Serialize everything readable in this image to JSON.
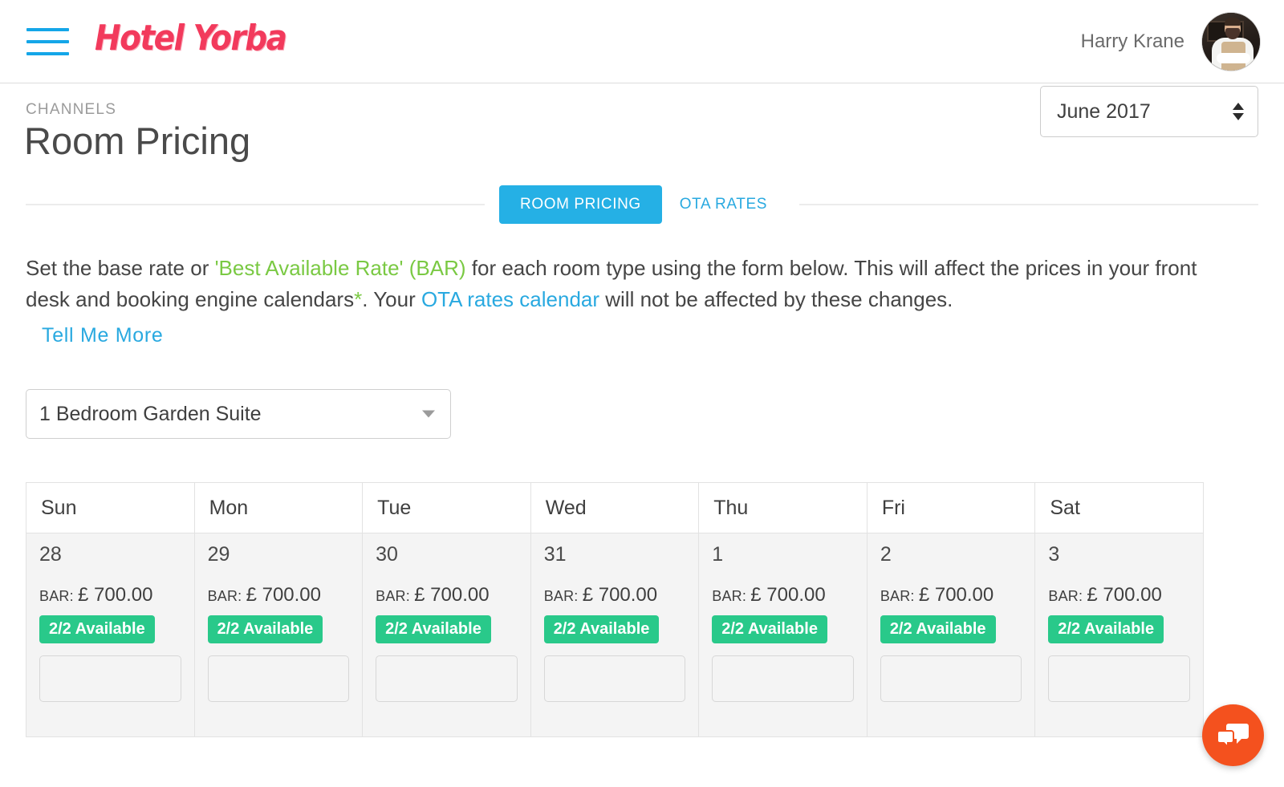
{
  "header": {
    "menu_icon": "hamburger-menu-icon",
    "brand": "Hotel Yorba",
    "user_name": "Harry Krane",
    "avatar_alt": "user-avatar"
  },
  "page": {
    "breadcrumb": "CHANNELS",
    "title": "Room Pricing",
    "month_selected": "June 2017",
    "month_options": [
      "June 2017"
    ]
  },
  "tabs": [
    {
      "label": "ROOM PRICING",
      "active": true
    },
    {
      "label": "OTA RATES",
      "active": false
    }
  ],
  "description": {
    "part1": "Set the base rate or ",
    "bar_term": "'Best Available Rate' (BAR)",
    "part2": " for each room type using the form below. This will affect the prices in your front desk and booking engine calendars",
    "star": "*",
    "part3": ". Your ",
    "ota_link": "OTA rates calendar",
    "part4": " will not be affected by these changes.",
    "tell_me_more": "Tell Me More"
  },
  "room_select": {
    "selected": "1 Bedroom Garden Suite",
    "options": [
      "1 Bedroom Garden Suite"
    ]
  },
  "calendar": {
    "day_headers": [
      "Sun",
      "Mon",
      "Tue",
      "Wed",
      "Thu",
      "Fri",
      "Sat"
    ],
    "bar_label": "BAR:",
    "currency_symbol": "£",
    "rate_input_placeholder": "",
    "rate_input_value": "",
    "rows": [
      {
        "cells": [
          {
            "day": "28",
            "price": "700.00",
            "availability": "2/2 Available",
            "rate_value": ""
          },
          {
            "day": "29",
            "price": "700.00",
            "availability": "2/2 Available",
            "rate_value": ""
          },
          {
            "day": "30",
            "price": "700.00",
            "availability": "2/2 Available",
            "rate_value": ""
          },
          {
            "day": "31",
            "price": "700.00",
            "availability": "2/2 Available",
            "rate_value": ""
          },
          {
            "day": "1",
            "price": "700.00",
            "availability": "2/2 Available",
            "rate_value": ""
          },
          {
            "day": "2",
            "price": "700.00",
            "availability": "2/2 Available",
            "rate_value": ""
          },
          {
            "day": "3",
            "price": "700.00",
            "availability": "2/2 Available",
            "rate_value": ""
          }
        ]
      }
    ]
  },
  "chat": {
    "icon": "chat-bubbles-icon"
  },
  "colors": {
    "brand_pink": "#f23a5c",
    "accent_blue": "#29a9e0",
    "tab_active_blue": "#25b0e5",
    "green_badge": "#29c98a",
    "green_text": "#7ac943",
    "chat_orange": "#f4511e"
  }
}
